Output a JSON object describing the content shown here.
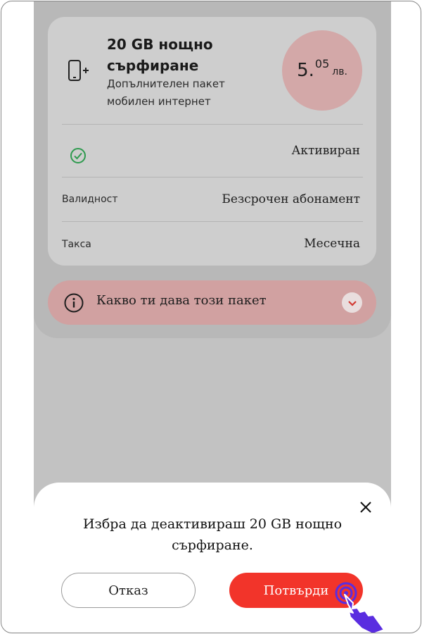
{
  "package": {
    "title": "20 GB нощно сърфиране",
    "subtitle": "Допълнителен пакет мобилен интернет",
    "price": {
      "main": "5.",
      "cents": "05",
      "currency": "лв."
    }
  },
  "details": {
    "status": {
      "value": "Активиран"
    },
    "validity": {
      "label": "Валидност",
      "value": "Безсрочен абонамент"
    },
    "fee": {
      "label": "Такса",
      "value": "Месечна"
    }
  },
  "info_bar": {
    "label": "Какво ти дава този пакет"
  },
  "dialog": {
    "message": "Избра да деактивираш 20 GB нощно сърфиране.",
    "cancel_label": "Отказ",
    "confirm_label": "Потвърди"
  },
  "colors": {
    "accent": "#f2342a",
    "cursor": "#5a2de0",
    "status_ok": "#2e9a4e"
  },
  "icons": [
    "phone-plus-icon",
    "check-circle-icon",
    "info-icon",
    "chevron-down-icon",
    "close-icon",
    "hand-pointer-icon"
  ]
}
